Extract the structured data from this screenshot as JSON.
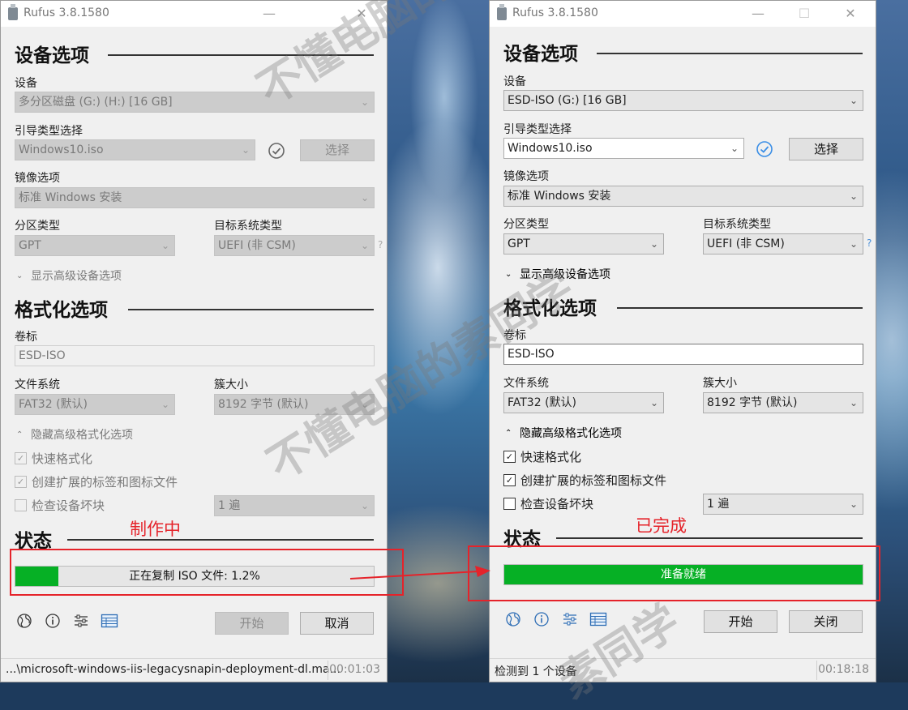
{
  "left": {
    "title": "Rufus 3.8.1580",
    "device_section": "设备选项",
    "device_label": "设备",
    "device_value": "多分区磁盘 (G:) (H:) [16 GB]",
    "boot_label": "引导类型选择",
    "boot_value": "Windows10.iso",
    "select_btn": "选择",
    "image_label": "镜像选项",
    "image_value": "标准 Windows 安装",
    "partition_label": "分区类型",
    "partition_value": "GPT",
    "target_label": "目标系统类型",
    "target_value": "UEFI (非 CSM)",
    "help": "?",
    "adv_device": "显示高级设备选项",
    "format_section": "格式化选项",
    "volume_label": "卷标",
    "volume_value": "ESD-ISO",
    "fs_label": "文件系统",
    "fs_value": "FAT32 (默认)",
    "cluster_label": "簇大小",
    "cluster_value": "8192 字节 (默认)",
    "adv_format": "隐藏高级格式化选项",
    "quick_format": "快速格式化",
    "ext_label": "创建扩展的标签和图标文件",
    "bad_blocks": "检查设备坏块",
    "passes": "1 遍",
    "status_section": "状态",
    "progress_text": "正在复制 ISO 文件: 1.2%",
    "progress_fraction": 0.12,
    "start_btn": "开始",
    "cancel_btn": "取消",
    "status_text": "...\\microsoft-windows-iis-legacysnapin-deployment-dl.ma...",
    "time": "00:01:03"
  },
  "right": {
    "title": "Rufus 3.8.1580",
    "device_section": "设备选项",
    "device_label": "设备",
    "device_value": "ESD-ISO (G:) [16 GB]",
    "boot_label": "引导类型选择",
    "boot_value": "Windows10.iso",
    "select_btn": "选择",
    "image_label": "镜像选项",
    "image_value": "标准 Windows 安装",
    "partition_label": "分区类型",
    "partition_value": "GPT",
    "target_label": "目标系统类型",
    "target_value": "UEFI (非 CSM)",
    "help": "?",
    "adv_device": "显示高级设备选项",
    "format_section": "格式化选项",
    "volume_label": "卷标",
    "volume_value": "ESD-ISO",
    "fs_label": "文件系统",
    "fs_value": "FAT32 (默认)",
    "cluster_label": "簇大小",
    "cluster_value": "8192 字节 (默认)",
    "adv_format": "隐藏高级格式化选项",
    "quick_format": "快速格式化",
    "ext_label": "创建扩展的标签和图标文件",
    "bad_blocks": "检查设备坏块",
    "passes": "1 遍",
    "status_section": "状态",
    "progress_text": "准备就绪",
    "progress_fraction": 1.0,
    "start_btn": "开始",
    "close_btn": "关闭",
    "status_text": "检测到 1 个设备",
    "time": "00:18:18"
  },
  "annotations": {
    "making": "制作中",
    "done": "已完成"
  },
  "watermark": {
    "line1": "不懂电脑的",
    "line2": "不懂电脑的素同学",
    "line3": "素同学"
  },
  "colors": {
    "progress_green": "#06b025",
    "annotation_red": "#e5232a",
    "check_blue": "#3a8ee6"
  }
}
